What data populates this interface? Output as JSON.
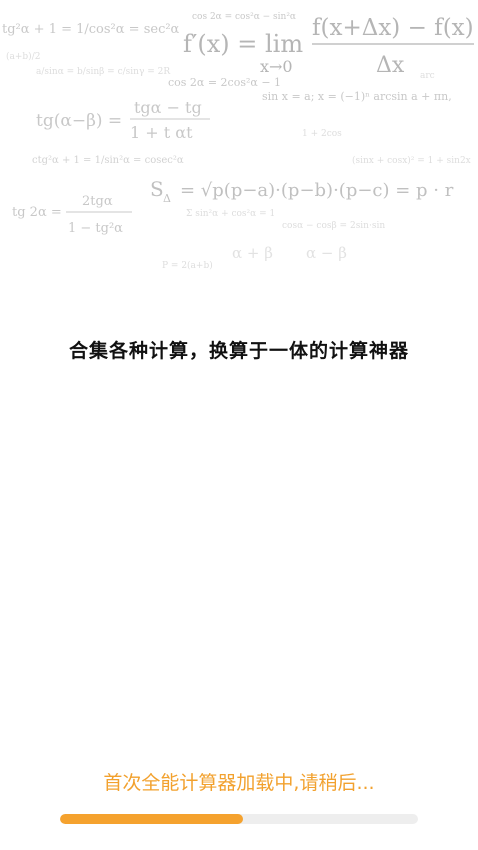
{
  "background": {
    "formulas": [
      "tg²α + 1 = 1/cos²α = sec²α",
      "cos 2α = cos²α − sin²α",
      "f′(x) = lim",
      "x→0",
      "f(x+Δx) − f(x)",
      "Δx",
      "cos 2α = 2cos²α − 1",
      "sin x = a;  x = (−1)ⁿ arcsin a + πn,",
      "tg(α−β) =",
      "tgα − tg",
      "1 + t  αt",
      "ctg²α + 1 = 1/sin²α = cosec²α",
      "S",
      "Δ",
      "= √p(p−a)·(p−b)·(p−c) = p · r",
      "tg 2α =",
      "2tgα",
      "1 − tg²α",
      "α + β",
      "α − β"
    ]
  },
  "tagline": "合集各种计算，换算于一体的计算神器",
  "loading": {
    "text": "首次全能计算器加载中,请稍后...",
    "progress": 0.51,
    "color_fill": "#f5a22e",
    "color_track": "#eeeeee",
    "color_text": "#f2a12e"
  }
}
